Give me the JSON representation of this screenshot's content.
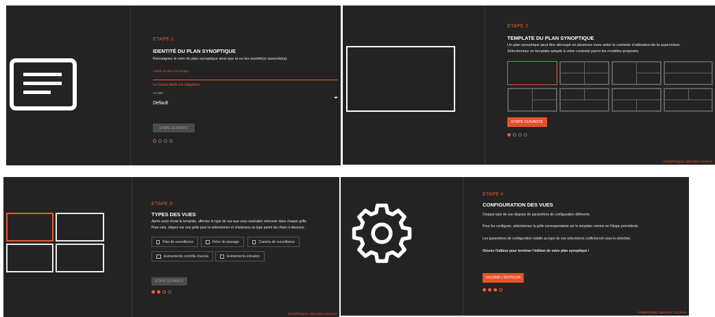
{
  "step1": {
    "step_label": "ETAPE 1",
    "title": "IDENTITÉ DU PLAN SYNOPTIQUE",
    "description": "Renseignez le nom du plan synoptique ainsi que la ou les société(s) associée(s).",
    "name_placeholder": "Libellé du plan synoptique",
    "error": "Le champ libellé est obligatoire.",
    "company_label": "Société",
    "company_value": "Default",
    "next_button": "ETAPE SUIVANTE"
  },
  "step2": {
    "step_label": "ETAPE 2",
    "title": "TEMPLATE DU PLAN SYNOPTIQUE",
    "line1": "Un plan synoptique peut être découpé en plusieurs vues selon le contexte d'utilisation de la supervision.",
    "line2": "Sélectionnez un template adapté à votre contexte parmi les modèles proposés.",
    "next_button": "ETAPE SUIVANTE",
    "footer": "SYNOPTIQUE | DEVANT L'ECRAN"
  },
  "step3": {
    "step_label": "ETAPE 3",
    "title": "TYPES DES VUES",
    "line1": "Après avoir choisi le template, affectez le type de vue que vous souhaitez retrouver dans chaque grille.",
    "line2": "Pour cela, cliquez sur une grille pour la sélectionner et choisissez un type parmi les choix ci-dessous :",
    "view_types": [
      "Plan de surveillance",
      "Fiche de passage",
      "Caméra de surveillance",
      "Evènements contrôle d'accès",
      "Evènements intrusion"
    ],
    "next_button": "ETAPE SUIVANTE",
    "footer": "SYNOPTIQUE | DEVANT L'ECRAN"
  },
  "step4": {
    "step_label": "ETAPE 4",
    "title": "CONFIGURATION DES VUES",
    "line1": "Chaque type de vue dispose de paramètres de configuration différents.",
    "line2": "Pour les configurer, sélectionnez la grille correspondante sur le template comme en l'étape précédente.",
    "line3": "Les paramètres de configuration relatifs au type de vue sélectionné s'afficheront sous la sélection.",
    "line4": "Ouvrez l'éditeur pour terminer l'édition de votre plan synoptique !",
    "open_button": "OUVRIR L'ÉDITEUR",
    "footer": "SYNOPTIQUE | DEVANT L'ECRAN"
  },
  "colors": {
    "accent": "#e85c3a",
    "panel": "#232323"
  }
}
